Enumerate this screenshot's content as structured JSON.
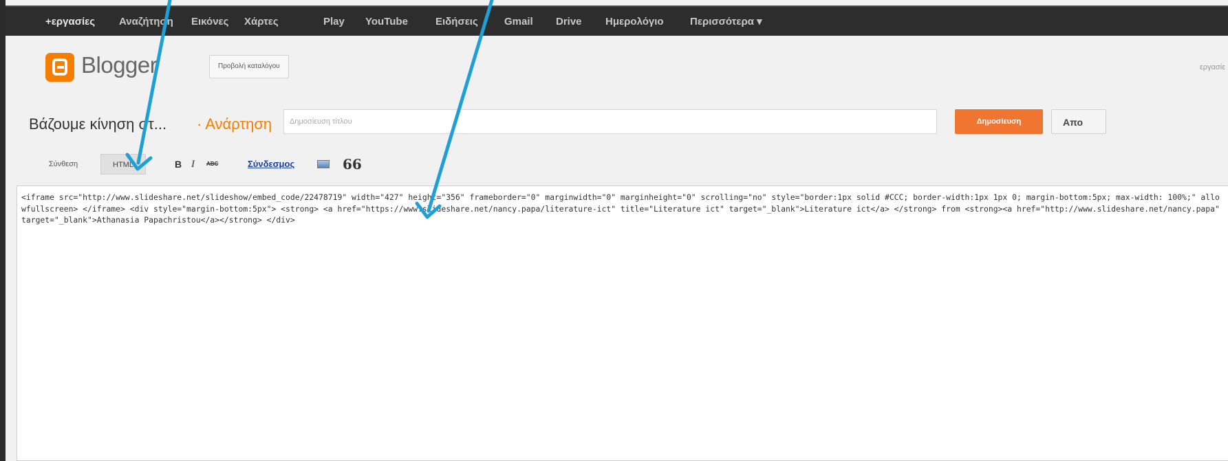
{
  "google_bar": {
    "items": [
      "+εργασίες",
      "Αναζήτηση",
      "Εικόνες",
      "Χάρτες",
      "Play",
      "YouTube",
      "Ειδήσεις",
      "Gmail",
      "Drive",
      "Ημερολόγιο",
      "Περισσότερα ▾"
    ]
  },
  "header": {
    "brand": "Blogger",
    "view_list_button": "Προβολή καταλόγου",
    "account": "εργασίε"
  },
  "post_bar": {
    "blog_title": "Βάζουμε κίνηση στ...",
    "post_label": "· Ανάρτηση",
    "title_placeholder": "Δημοσίευση τίτλου",
    "publish_button": "Δημοσίευση",
    "save_button": "Απο"
  },
  "toolbar": {
    "compose_tab": "Σύνθεση",
    "html_tab": "HTML",
    "bold": "B",
    "italic": "I",
    "strike": "ABC",
    "link": "Σύνδεσμος",
    "quote": "66"
  },
  "editor": {
    "content": "<iframe src=\"http://www.slideshare.net/slideshow/embed_code/22478719\" width=\"427\" height=\"356\" frameborder=\"0\" marginwidth=\"0\" marginheight=\"0\" scrolling=\"no\" style=\"border:1px solid #CCC; border-width:1px 1px 0; margin-bottom:5px; max-width: 100%;\" allowfullscreen> </iframe> <div style=\"margin-bottom:5px\"> <strong> <a href=\"https://www.slideshare.net/nancy.papa/literature-ict\" title=\"Literature ict\" target=\"_blank\">Literature ict</a> </strong> from <strong><a href=\"http://www.slideshare.net/nancy.papa\" target=\"_blank\">Athanasia Papachristou</a></strong> </div>"
  },
  "colors": {
    "accent": "#f57d00",
    "publish": "#f07530",
    "annotation_arrow": "#1e9fd6",
    "topbar": "#2d2d2d"
  }
}
